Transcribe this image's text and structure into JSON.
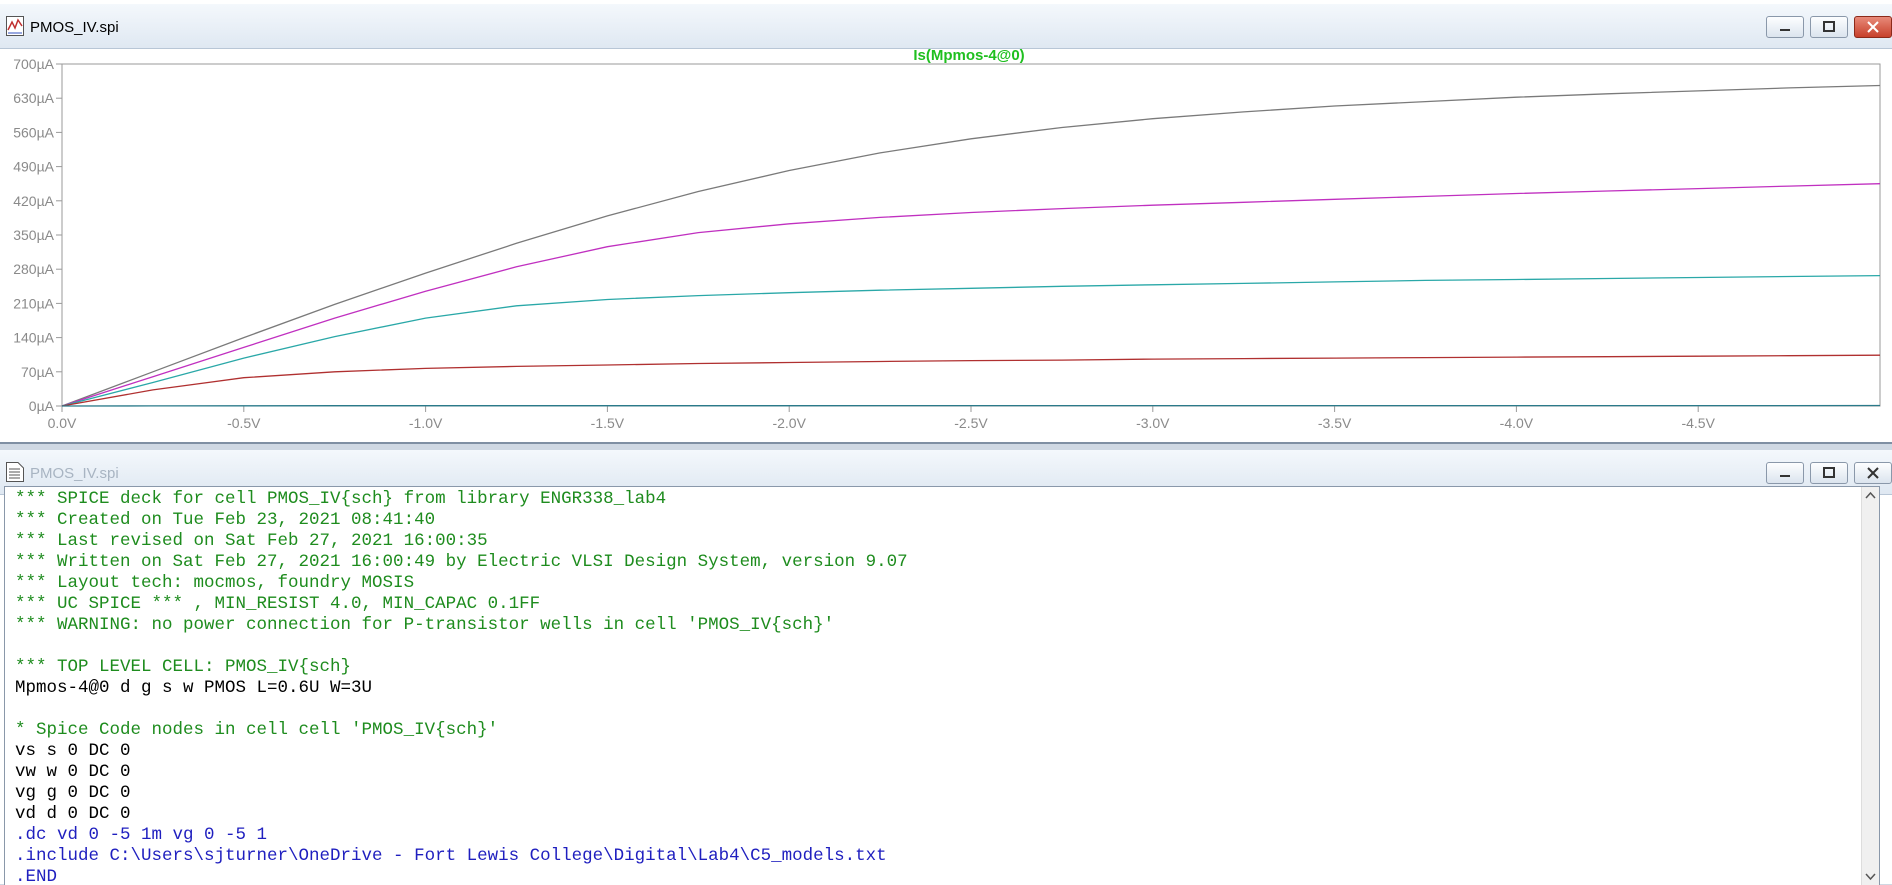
{
  "plot_window": {
    "title": "PMOS_IV.spi",
    "icon": "waveform-icon",
    "controls": [
      "minimize-icon",
      "maximize-icon",
      "close-icon"
    ]
  },
  "text_window": {
    "title": "PMOS_IV.spi",
    "icon": "document-icon",
    "controls": [
      "minimize-icon",
      "maximize-icon",
      "close-icon"
    ],
    "lines": [
      {
        "text": "*** SPICE deck for cell PMOS_IV{sch} from library ENGR338_lab4",
        "kind": "comment"
      },
      {
        "text": "*** Created on Tue Feb 23, 2021 08:41:40",
        "kind": "comment"
      },
      {
        "text": "*** Last revised on Sat Feb 27, 2021 16:00:35",
        "kind": "comment"
      },
      {
        "text": "*** Written on Sat Feb 27, 2021 16:00:49 by Electric VLSI Design System, version 9.07",
        "kind": "comment"
      },
      {
        "text": "*** Layout tech: mocmos, foundry MOSIS",
        "kind": "comment"
      },
      {
        "text": "*** UC SPICE *** , MIN_RESIST 4.0, MIN_CAPAC 0.1FF",
        "kind": "comment"
      },
      {
        "text": "*** WARNING: no power connection for P-transistor wells in cell 'PMOS_IV{sch}'",
        "kind": "comment"
      },
      {
        "text": "",
        "kind": "plain"
      },
      {
        "text": "*** TOP LEVEL CELL: PMOS_IV{sch}",
        "kind": "comment"
      },
      {
        "text": "Mpmos-4@0 d g s w PMOS L=0.6U W=3U",
        "kind": "plain"
      },
      {
        "text": "",
        "kind": "plain"
      },
      {
        "text": "* Spice Code nodes in cell cell 'PMOS_IV{sch}'",
        "kind": "comment"
      },
      {
        "text": "vs s 0 DC 0",
        "kind": "plain"
      },
      {
        "text": "vw w 0 DC 0",
        "kind": "plain"
      },
      {
        "text": "vg g 0 DC 0",
        "kind": "plain"
      },
      {
        "text": "vd d 0 DC 0",
        "kind": "plain"
      },
      {
        "text": ".dc vd 0 -5 1m vg 0 -5 1",
        "kind": "directive"
      },
      {
        "text": ".include C:\\Users\\sjturner\\OneDrive - Fort Lewis College\\Digital\\Lab4\\C5_models.txt",
        "kind": "directive"
      },
      {
        "text": ".END",
        "kind": "directive"
      }
    ]
  },
  "colors": {
    "comment": "#1e8c1e",
    "plain": "#000000",
    "directive": "#1f1fbf",
    "axis_text": "#8a8a8a",
    "trace_label": "#1fbf1f"
  },
  "chart_data": {
    "type": "line",
    "title": "Is(Mpmos-4@0)",
    "xlabel": "",
    "ylabel": "",
    "x_ticks": [
      "0.0V",
      "-0.5V",
      "-1.0V",
      "-1.5V",
      "-2.0V",
      "-2.5V",
      "-3.0V",
      "-3.5V",
      "-4.0V",
      "-4.5V"
    ],
    "y_ticks": [
      "0µA",
      "70µA",
      "140µA",
      "210µA",
      "280µA",
      "350µA",
      "420µA",
      "490µA",
      "560µA",
      "630µA",
      "700µA"
    ],
    "xlim": [
      0,
      -5
    ],
    "ylim": [
      0,
      700
    ],
    "grid": false,
    "x": [
      0,
      -0.25,
      -0.5,
      -0.75,
      -1.0,
      -1.25,
      -1.5,
      -1.75,
      -2.0,
      -2.25,
      -2.5,
      -2.75,
      -3.0,
      -3.25,
      -3.5,
      -3.75,
      -4.0,
      -4.25,
      -4.5,
      -4.75,
      -5.0
    ],
    "series": [
      {
        "color": "#7a7a7a",
        "values": [
          0,
          70,
          140,
          208,
          272,
          333,
          389,
          439,
          482,
          518,
          547,
          570,
          588,
          602,
          614,
          623,
          632,
          639,
          645,
          651,
          656
        ]
      },
      {
        "color": "#c030c0",
        "values": [
          0,
          60,
          120,
          180,
          235,
          285,
          326,
          355,
          373,
          386,
          396,
          404,
          411,
          417,
          423,
          429,
          435,
          440,
          445,
          450,
          455
        ]
      },
      {
        "color": "#2aa8a8",
        "values": [
          0,
          48,
          98,
          142,
          180,
          205,
          218,
          226,
          232,
          237,
          241,
          245,
          248,
          251,
          254,
          257,
          259,
          261,
          263,
          265,
          267
        ]
      },
      {
        "color": "#b03030",
        "values": [
          0,
          33,
          58,
          70,
          77,
          81,
          84,
          87,
          89,
          91,
          93,
          94,
          96,
          97,
          98,
          99,
          100,
          101,
          102,
          103,
          104
        ]
      },
      {
        "color": "#2a7a8a",
        "values": [
          0,
          0.3,
          0.5,
          0.6,
          0.6,
          0.7,
          0.7,
          0.7,
          0.7,
          0.8,
          0.8,
          0.8,
          0.8,
          0.8,
          0.8,
          0.9,
          0.9,
          0.9,
          0.9,
          0.9,
          1.0
        ]
      }
    ]
  }
}
